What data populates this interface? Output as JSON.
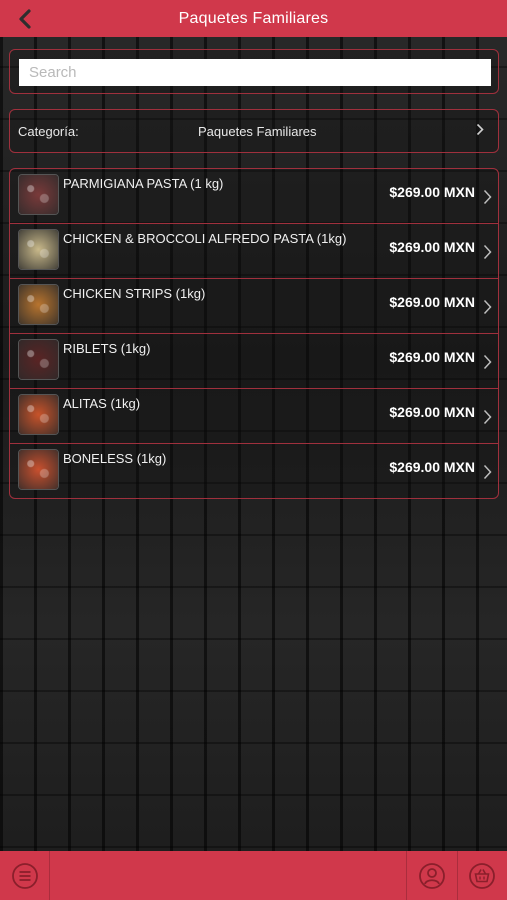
{
  "header": {
    "title": "Paquetes Familiares",
    "back_icon": "chevron-left-icon"
  },
  "search": {
    "placeholder": "Search",
    "value": ""
  },
  "category": {
    "label": "Categoría:",
    "value": "Paquetes Familiares",
    "icon": "chevron-right-icon"
  },
  "products": [
    {
      "name": "PARMIGIANA PASTA (1 kg)",
      "price": "$269.00 MXN",
      "thumb_color": "#7a3a3a"
    },
    {
      "name": "CHICKEN & BROCCOLI ALFREDO PASTA (1kg)",
      "price": "$269.00 MXN",
      "thumb_color": "#c9b98a"
    },
    {
      "name": "CHICKEN STRIPS (1kg)",
      "price": "$269.00 MXN",
      "thumb_color": "#b8742e"
    },
    {
      "name": "RIBLETS (1kg)",
      "price": "$269.00 MXN",
      "thumb_color": "#5a2424"
    },
    {
      "name": "ALITAS (1kg)",
      "price": "$269.00 MXN",
      "thumb_color": "#c8532a"
    },
    {
      "name": "BONELESS (1kg)",
      "price": "$269.00 MXN",
      "thumb_color": "#c9502e"
    }
  ],
  "bottom_nav": {
    "menu_icon": "menu-icon",
    "profile_icon": "user-icon",
    "cart_icon": "basket-icon"
  },
  "colors": {
    "brand_red": "#d0384b",
    "border_red": "#a0303d"
  }
}
